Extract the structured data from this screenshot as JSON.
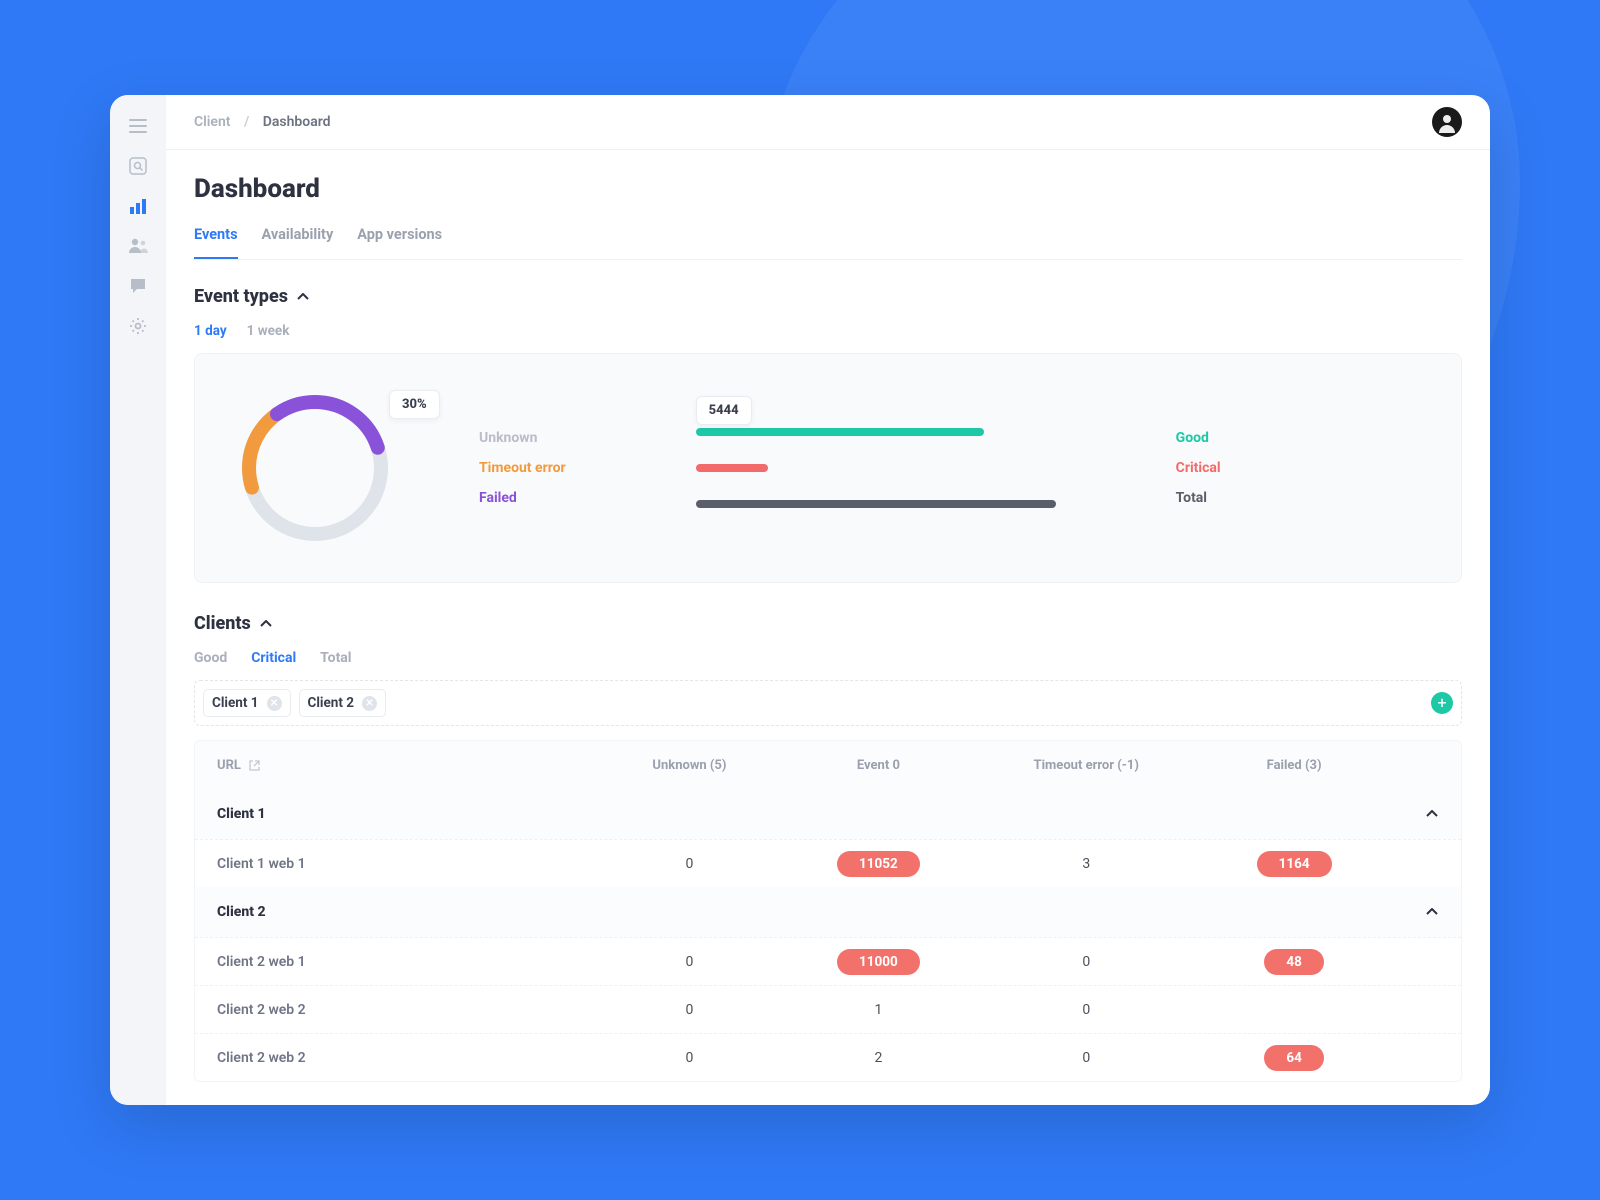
{
  "breadcrumb": {
    "parent": "Client",
    "sep": "/",
    "current": "Dashboard"
  },
  "page_title": "Dashboard",
  "tabs": [
    {
      "label": "Events",
      "selected": true
    },
    {
      "label": "Availability",
      "selected": false
    },
    {
      "label": "App versions",
      "selected": false
    }
  ],
  "event_types": {
    "title": "Event types",
    "ranges": [
      {
        "label": "1 day",
        "selected": true
      },
      {
        "label": "1 week",
        "selected": false
      }
    ],
    "donut_badge": "30%",
    "legend1": {
      "unknown": {
        "label": "Unknown",
        "color": "#b8bdc9"
      },
      "timeout": {
        "label": "Timeout error",
        "color": "#f19a3e"
      },
      "failed": {
        "label": "Failed",
        "color": "#8a52d8"
      }
    },
    "bar_badge": "5444",
    "legend2": {
      "good": {
        "label": "Good",
        "color": "#1cc8a5"
      },
      "critical": {
        "label": "Critical",
        "color": "#f26a6a"
      },
      "total": {
        "label": "Total",
        "color": "#5a5e68"
      }
    }
  },
  "chart_data": [
    {
      "type": "pie",
      "title": "Event types (donut)",
      "series": [
        {
          "name": "Failed",
          "value": 30,
          "color": "#8a52d8"
        },
        {
          "name": "Timeout error",
          "value": 20,
          "color": "#f19a3e"
        },
        {
          "name": "Unknown",
          "value": 50,
          "color": "#dfe3ea"
        }
      ],
      "highlighted": {
        "name": "Failed",
        "label": "30%"
      }
    },
    {
      "type": "bar",
      "orientation": "horizontal",
      "title": "Event counts",
      "categories": [
        "Good",
        "Critical",
        "Total"
      ],
      "values": [
        5444,
        1300,
        6800
      ],
      "colors": [
        "#1cc8a5",
        "#f26a6a",
        "#5a5e68"
      ],
      "xlim": [
        0,
        7600
      ],
      "highlighted": {
        "name": "Good",
        "label": "5444"
      }
    }
  ],
  "clients": {
    "title": "Clients",
    "filters": [
      {
        "label": "Good",
        "selected": false
      },
      {
        "label": "Critical",
        "selected": true
      },
      {
        "label": "Total",
        "selected": false
      }
    ],
    "chips": [
      {
        "label": "Client 1"
      },
      {
        "label": "Client 2"
      }
    ],
    "columns": {
      "url": "URL",
      "unknown": "Unknown (5)",
      "event0": "Event 0",
      "timeout": "Timeout error (-1)",
      "failed": "Failed (3)"
    },
    "groups": [
      {
        "name": "Client 1",
        "rows": [
          {
            "url": "Client 1 web 1",
            "unknown": "0",
            "event0": "11052",
            "event0_pill": true,
            "timeout": "3",
            "failed": "1164",
            "failed_pill": true
          }
        ]
      },
      {
        "name": "Client 2",
        "rows": [
          {
            "url": "Client 2 web 1",
            "unknown": "0",
            "event0": "11000",
            "event0_pill": true,
            "timeout": "0",
            "failed": "48",
            "failed_pill": true
          },
          {
            "url": "Client 2 web 2",
            "unknown": "0",
            "event0": "1",
            "event0_pill": false,
            "timeout": "0",
            "failed": "",
            "failed_pill": false
          },
          {
            "url": "Client 2 web 2",
            "unknown": "0",
            "event0": "2",
            "event0_pill": false,
            "timeout": "0",
            "failed": "64",
            "failed_pill": true
          }
        ]
      }
    ]
  }
}
